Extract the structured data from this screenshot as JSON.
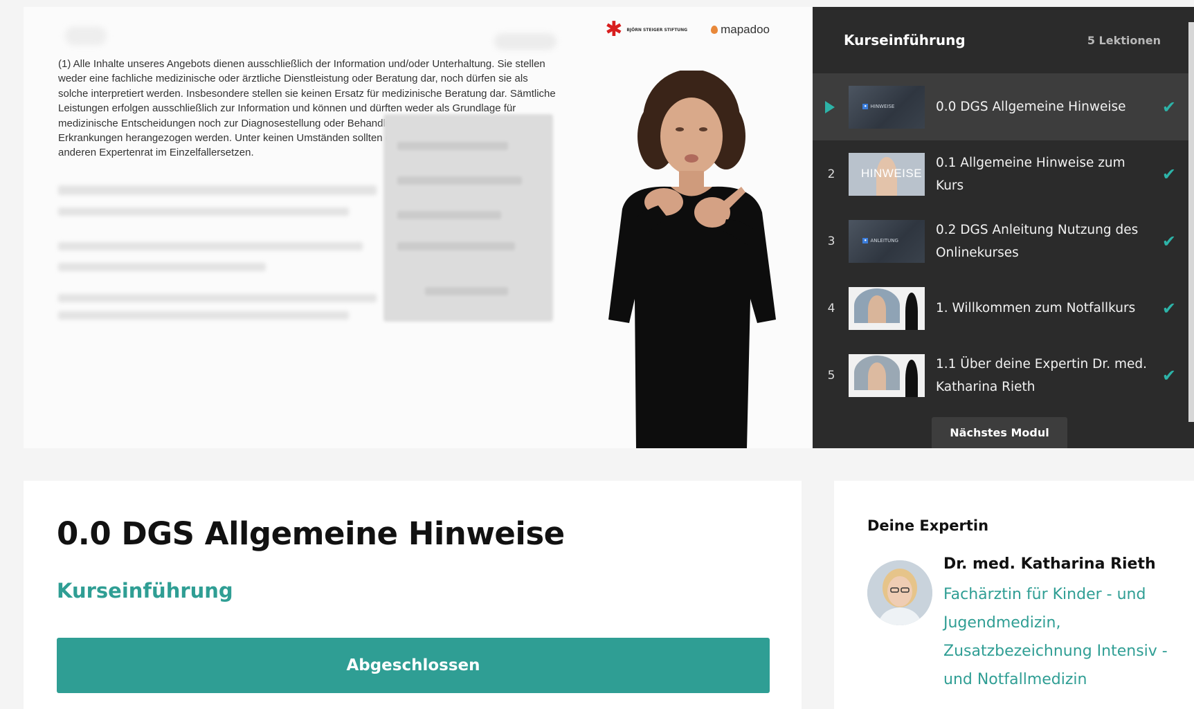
{
  "video": {
    "logo_steiger": "BJÖRN STEIGER STIFTUNG",
    "logo_mapadoo": "mapadoo",
    "disclaimer": "(1) Alle Inhalte unseres Angebots dienen ausschließlich der Information und/oder Unterhaltung. Sie stellen weder eine fachliche medizinische oder ärztliche Dienstleistung oder Beratung dar, noch dürfen sie als solche interpretiert werden. Insbesondere stellen sie keinen Ersatz für medizinische Beratung dar. Sämtliche Leistungen erfolgen ausschließlich zur Information und können und dürften weder als Grundlage für medizinische Entscheidungen noch zur Diagnosestellung oder Behandlung von Beschwerden oder Erkrankungen herangezogen werden. Unter keinen Umständen sollten diese den Arztbesuch oder einen anderen Expertenrat im Einzelfallersetzen."
  },
  "playlist": {
    "title": "Kurseinführung",
    "count": "5 Lektionen",
    "items": [
      {
        "num": "",
        "title": "0.0 DGS Allgemeine Hinweise",
        "thumb_label": "HINWEISE",
        "thumb_style": "dark",
        "active": true,
        "check": "✔"
      },
      {
        "num": "2",
        "title": "0.1 Allgemeine Hinweise zum Kurs",
        "thumb_label": "HINWEISE",
        "thumb_style": "light",
        "active": false,
        "check": "✔"
      },
      {
        "num": "3",
        "title": "0.2 DGS Anleitung Nutzung des Onlinekurses",
        "thumb_label": "ANLEITUNG",
        "thumb_style": "dark",
        "active": false,
        "check": "✔"
      },
      {
        "num": "4",
        "title": "1. Willkommen zum Notfallkurs",
        "thumb_label": "",
        "thumb_style": "white",
        "active": false,
        "check": "✔"
      },
      {
        "num": "5",
        "title": "1.1 Über deine Expertin Dr. med. Katharina Rieth",
        "thumb_label": "",
        "thumb_style": "white",
        "active": false,
        "check": "✔"
      }
    ],
    "next_label": "Nächstes Modul"
  },
  "lesson": {
    "title": "0.0 DGS Allgemeine Hinweise",
    "course": "Kurseinführung",
    "button_label": "Abgeschlossen"
  },
  "expert": {
    "heading": "Deine Expertin",
    "name": "Dr. med. Katharina Rieth",
    "specialty": "Fachärztin für Kinder - und Jugendmedizin, Zusatzbezeichnung Intensiv - und Notfallmedizin"
  },
  "colors": {
    "accent": "#2f9e94",
    "playlist_bg": "#2b2b2b",
    "playlist_active_bg": "#3d3d3d"
  }
}
